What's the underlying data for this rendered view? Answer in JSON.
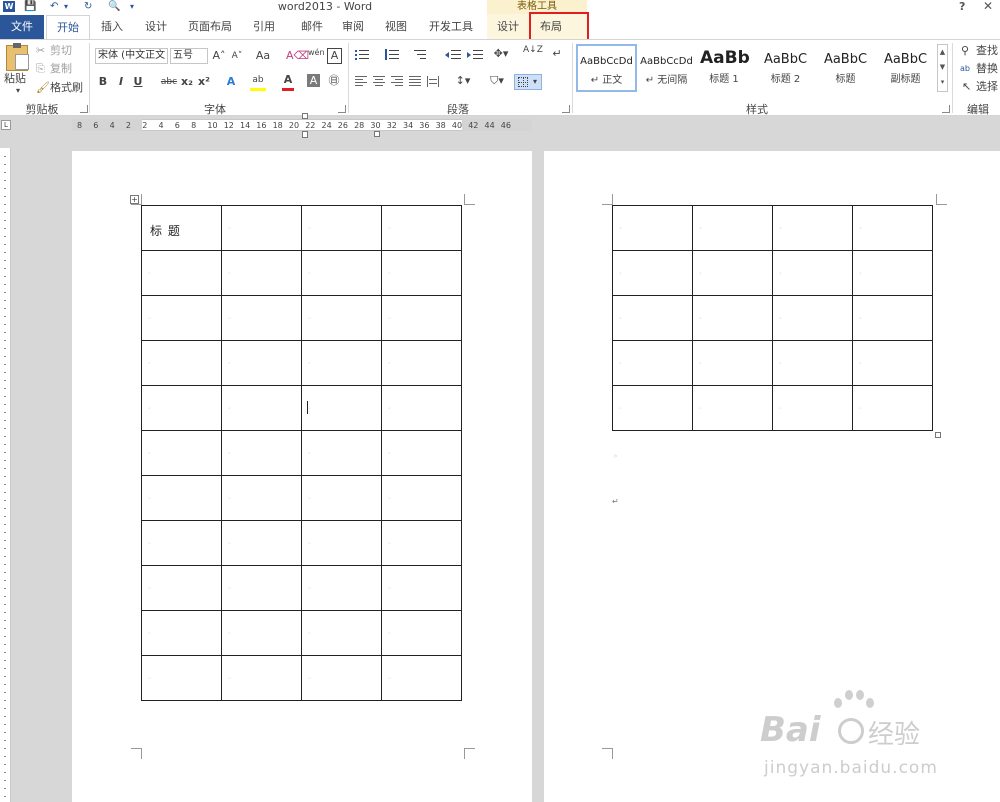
{
  "title_bar": {
    "app_icon": "W",
    "doc_title": "word2013 - Word",
    "context_title": "表格工具",
    "help": "?",
    "close": "✕",
    "quick_access": [
      "💾",
      "↶",
      "▾",
      "↻",
      "🔍",
      "▾"
    ]
  },
  "tabs": {
    "file": "文件",
    "home": "开始",
    "insert": "插入",
    "design": "设计",
    "page_layout": "页面布局",
    "references": "引用",
    "mailings": "邮件",
    "review": "审阅",
    "view": "视图",
    "developer": "开发工具",
    "table_design": "设计",
    "table_layout": "布局"
  },
  "clipboard": {
    "paste": "粘贴",
    "cut": "剪切",
    "copy": "复制",
    "format_painter": "格式刷",
    "group_label": "剪贴板"
  },
  "font": {
    "font_name": "宋体 (中文正文",
    "font_size": "五号",
    "grow": "A˄",
    "shrink": "A˅",
    "case": "Aa",
    "clear": "A⌫",
    "phonetic": "wén",
    "border_char": "A",
    "bold": "B",
    "italic": "I",
    "underline": "U",
    "strike": "abc",
    "subscript": "x₂",
    "superscript": "x²",
    "effects": "A",
    "highlight": "ab",
    "color": "A",
    "shade": "A",
    "enclose": "㊐",
    "group_label": "字体"
  },
  "paragraph": {
    "sort": "A↓Z",
    "show_marks": "↵",
    "group_label": "段落"
  },
  "styles": {
    "items": [
      {
        "sample": "AaBbCcDd",
        "name": "↵ 正文"
      },
      {
        "sample": "AaBbCcDd",
        "name": "↵ 无间隔"
      },
      {
        "sample": "AaBb",
        "name": "标题 1"
      },
      {
        "sample": "AaBbC",
        "name": "标题 2"
      },
      {
        "sample": "AaBbC",
        "name": "标题"
      },
      {
        "sample": "AaBbC",
        "name": "副标题"
      }
    ],
    "group_label": "样式"
  },
  "editing": {
    "find": "查找",
    "replace": "替换",
    "select": "选择",
    "group_label": "编辑"
  },
  "ruler": {
    "corner": "L",
    "numbers": [
      "8",
      "6",
      "4",
      "2",
      "2",
      "4",
      "6",
      "8",
      "10",
      "12",
      "14",
      "16",
      "18",
      "20",
      "22",
      "24",
      "26",
      "28",
      "30",
      "32",
      "34",
      "36",
      "38",
      "40",
      "42",
      "44",
      "46"
    ]
  },
  "document": {
    "cell_title": "标 题",
    "cell_mark": "◦",
    "para_mark": "↵"
  },
  "watermark": {
    "brand": "Bai",
    "brand_cn": "经验",
    "url": "jingyan.baidu.com"
  }
}
